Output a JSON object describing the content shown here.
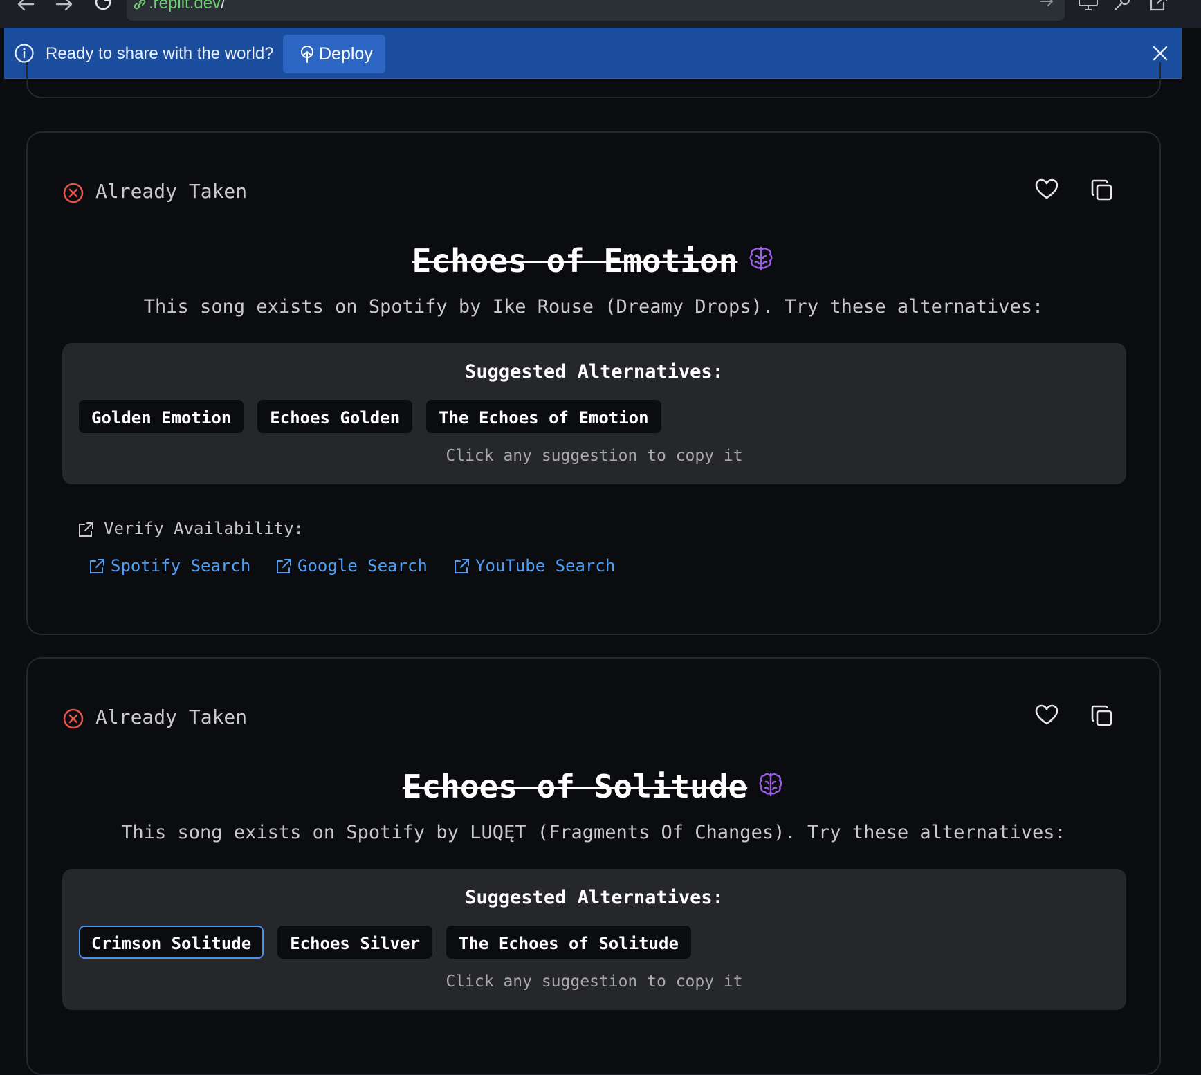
{
  "browser": {
    "url_host": ".replit.dev",
    "url_path": "/"
  },
  "banner": {
    "message": "Ready to share with the world?",
    "deploy_label": "Deploy"
  },
  "cards": [
    {
      "status": "Already Taken",
      "song_title": "Echoes of Emotion",
      "exists_text": "This song exists on Spotify by Ike Rouse (Dreamy Drops). Try these alternatives:",
      "suggest_title": "Suggested Alternatives:",
      "suggestions": [
        "Golden Emotion",
        "Echoes Golden",
        "The Echoes of Emotion"
      ],
      "click_hint": "Click any suggestion to copy it",
      "verify_label": "Verify Availability:",
      "verify_links": [
        "Spotify Search",
        "Google Search",
        "YouTube Search"
      ]
    },
    {
      "status": "Already Taken",
      "song_title": "Echoes of Solitude",
      "exists_text": "This song exists on Spotify by LUQĘT (Fragments Of Changes). Try these alternatives:",
      "suggest_title": "Suggested Alternatives:",
      "suggestions": [
        "Crimson Solitude",
        "Echoes Silver",
        "The Echoes of Solitude"
      ],
      "selected_suggestion": "Crimson Solitude",
      "click_hint": "Click any suggestion to copy it"
    }
  ],
  "colors": {
    "banner_bg": "#1a4d9e",
    "taken_red": "#e5534b",
    "brain_purple": "#9b5de5",
    "link_blue": "#4d9ef7",
    "selected_border": "#4a90f2"
  },
  "icons": [
    "back-arrow-icon",
    "forward-arrow-icon",
    "reload-icon",
    "link-icon",
    "info-icon",
    "deploy-icon",
    "close-icon",
    "x-circle-icon",
    "heart-icon",
    "copy-icon",
    "brain-icon",
    "external-link-icon"
  ]
}
